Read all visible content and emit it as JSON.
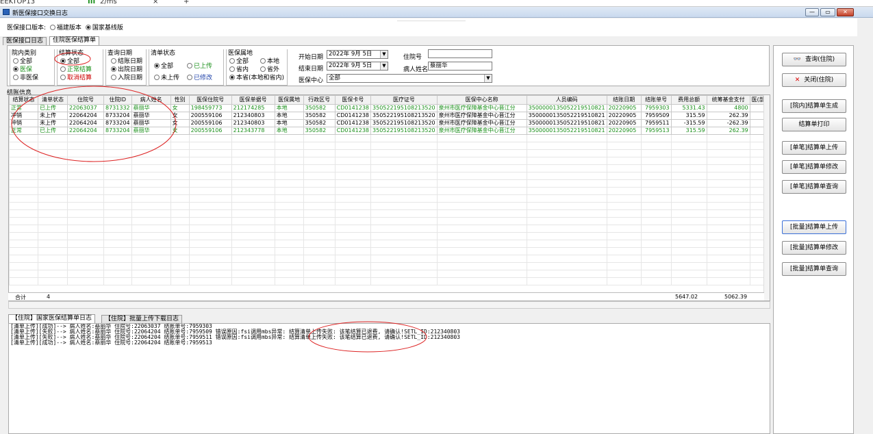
{
  "browser": {
    "left_text": "EEKTOP13",
    "mid_text": "2/ms",
    "pill": "III",
    "close": "×",
    "plus": "+"
  },
  "window": {
    "title": "新医保接口交换日志",
    "buttons": {
      "min": "—",
      "max": "▭",
      "close": "✕"
    }
  },
  "version": {
    "label": "医保接口版本:",
    "opt1": "福建版本",
    "opt2": "国家基线版",
    "selected": "国家基线版"
  },
  "tabs": [
    {
      "label": "医保接口日志"
    },
    {
      "label": "住院医保结算单"
    }
  ],
  "filters": {
    "yuanneileibie": {
      "title": "院内类别",
      "options": [
        "全部",
        "医保",
        "非医保"
      ],
      "selected": "医保"
    },
    "jiesuanzhuangtai": {
      "title": "结算状态",
      "options": [
        "全部",
        "正常结算",
        "取消结算"
      ],
      "selected": "全部"
    },
    "chaxunriqi": {
      "title": "查询日期",
      "options": [
        "结账日期",
        "出院日期",
        "入院日期"
      ],
      "selected": "出院日期"
    },
    "qingdanzhuangtai": {
      "title": "清单状态",
      "options": [
        "全部",
        "已上传",
        "未上传",
        "已修改"
      ],
      "selected": "全部"
    },
    "yibaoshudi": {
      "title": "医保属地",
      "options": [
        "全部",
        "本地",
        "省内",
        "省外",
        "本省(本地和省内)"
      ],
      "selected": "本省(本地和省内)"
    },
    "start_date": {
      "label": "开始日期",
      "value": "2022年 9月 5日"
    },
    "end_date": {
      "label": "结束日期",
      "value": "2022年 9月 5日"
    },
    "center": {
      "label": "医保中心",
      "value": "全部"
    },
    "zhuyuanhao": {
      "label": "住院号",
      "value": ""
    },
    "patient": {
      "label": "病人姓名",
      "value": "蔡丽华"
    }
  },
  "actions": {
    "query": "查询(住院)",
    "close": "关闭(住院)",
    "gen": "[院内]结算单生成",
    "print": "结算单打印",
    "s_up": "[单笔]结算单上传",
    "s_mod": "[单笔]结算单修改",
    "s_q": "[单笔]结算单查询",
    "b_up": "[批量]结算单上传",
    "b_mod": "[批量]结算单修改",
    "b_q": "[批量]结算单查询"
  },
  "grid": {
    "title": "结账信息",
    "columns": [
      "结算状态",
      "清单状态",
      "住院号",
      "住院ID",
      "病人姓名",
      "性别",
      "医保住院号",
      "医保单据号",
      "医保属地",
      "行政区号",
      "医保卡号",
      "医疗证号",
      "医保中心名称",
      "人员编码",
      "结账日期",
      "结账单号",
      "费用总额",
      "统筹基金支付",
      "医(部"
    ],
    "rows": [
      [
        "正常",
        "已上传",
        "22063037",
        "8731332",
        "蔡丽华",
        "女",
        "198459773",
        "212174285",
        "本地",
        "350582",
        "CD0141238",
        "350522195108213520",
        "泉州市医疗保障基金中心晋江分",
        "3500000135052219510821",
        "20220905",
        "7959303",
        "5331.43",
        "4800",
        ""
      ],
      [
        "冲销",
        "未上传",
        "22064204",
        "8733204",
        "蔡丽华",
        "女",
        "200559106",
        "212340803",
        "本地",
        "350582",
        "CD0141238",
        "350522195108213520",
        "泉州市医疗保障基金中心晋江分",
        "3500000135052219510821",
        "20220905",
        "7959509",
        "315.59",
        "262.39",
        ""
      ],
      [
        "冲销",
        "未上传",
        "22064204",
        "8733204",
        "蔡丽华",
        "女",
        "200559106",
        "212340803",
        "本地",
        "350582",
        "CD0141238",
        "350522195108213520",
        "泉州市医疗保障基金中心晋江分",
        "3500000135052219510821",
        "20220905",
        "7959511",
        "-315.59",
        "-262.39",
        ""
      ],
      [
        "正常",
        "已上传",
        "22064204",
        "8733204",
        "蔡丽华",
        "女",
        "200559106",
        "212343778",
        "本地",
        "350582",
        "CD0141238",
        "350522195108213520",
        "泉州市医疗保障基金中心晋江分",
        "3500000135052219510821",
        "20220905",
        "7959513",
        "315.59",
        "262.39",
        ""
      ]
    ],
    "total": {
      "label": "合计",
      "count": "4",
      "fee": "5647.02",
      "fund": "5062.39"
    }
  },
  "logtabs": [
    {
      "label": "【住院】国家医保结算单日志"
    },
    {
      "label": "【住院】批量上传下载日志"
    }
  ],
  "log": [
    "[清单上传][成功]--> 病人姓名:蔡丽华  住院号:22063037  结账单号:7959303",
    "[清单上传][失败]--> 病人姓名:蔡丽华  住院号:22064204  结账单号:7959509 错误原因:fsi调用mbs异常: 结算清单上传失败: 该笔结算已退费, 请确认!SETL_ID:212340803",
    "[清单上传][失败]--> 病人姓名:蔡丽华  住院号:22064204  结账单号:7959511 错误原因:fsi调用mbs异常: 结算清单上传失败: 该笔结算已退费, 请确认!SETL_ID:212340803",
    "[清单上传][成功]--> 病人姓名:蔡丽华  住院号:22064204  结账单号:7959513"
  ],
  "colors": {
    "annotation_red": "#d22",
    "green_text": "#1a8f1a"
  }
}
